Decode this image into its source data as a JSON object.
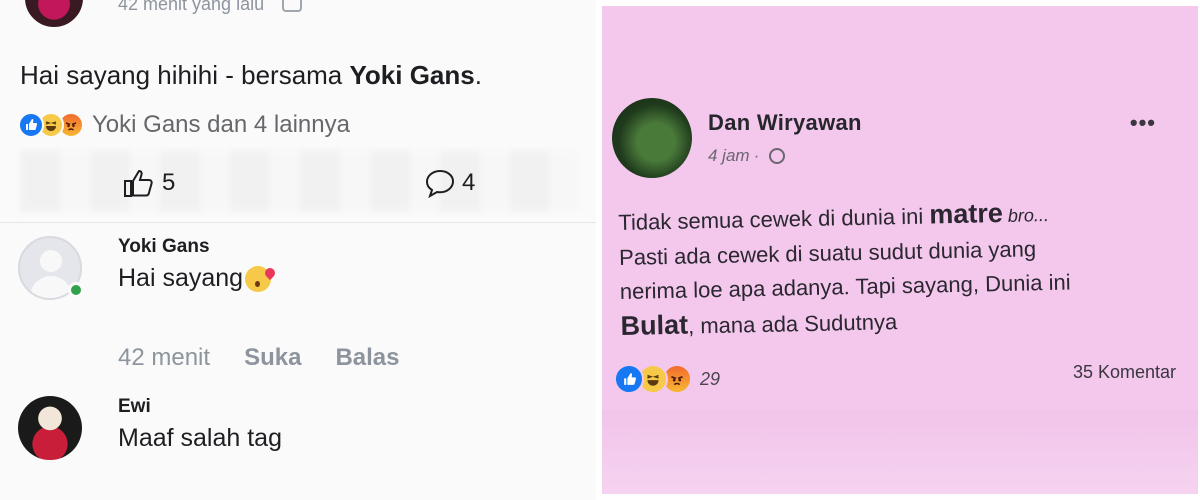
{
  "left": {
    "top_meta": {
      "time": "42 menit yang lalu"
    },
    "post": {
      "text": "Hai sayang hihihi - bersama ",
      "tagged": "Yoki Gans",
      "end": "."
    },
    "reactions": {
      "text": "Yoki Gans dan 4 lainnya",
      "icons": [
        "like-icon",
        "haha-icon",
        "angry-icon"
      ]
    },
    "stats": {
      "likes": "5",
      "comments": "4"
    },
    "comments": [
      {
        "name": "Yoki Gans",
        "text": "Hai sayang",
        "emoji": "kiss-emoji"
      },
      {
        "name": "Ewi",
        "text": "Maaf salah tag"
      }
    ],
    "comment_actions": {
      "time": "42 menit",
      "like": "Suka",
      "reply": "Balas"
    }
  },
  "right": {
    "author": "Dan Wiryawan",
    "time": "4 jam",
    "menu": "•••",
    "post_lines": [
      {
        "parts": [
          "Tidak semua cewek di dunia ini ",
          "matre",
          " bro..."
        ]
      },
      {
        "parts": [
          "Pasti ada cewek di suatu sudut dunia yang"
        ]
      },
      {
        "parts": [
          "nerima loe apa adanya. Tapi sayang, Dunia ini"
        ]
      },
      {
        "parts": [
          "Bulat",
          ", mana ada Sudutnya"
        ]
      }
    ],
    "reaction_count": "29",
    "comments_label": "35 Komentar",
    "colors": {
      "background": "#f3c8ec"
    }
  }
}
